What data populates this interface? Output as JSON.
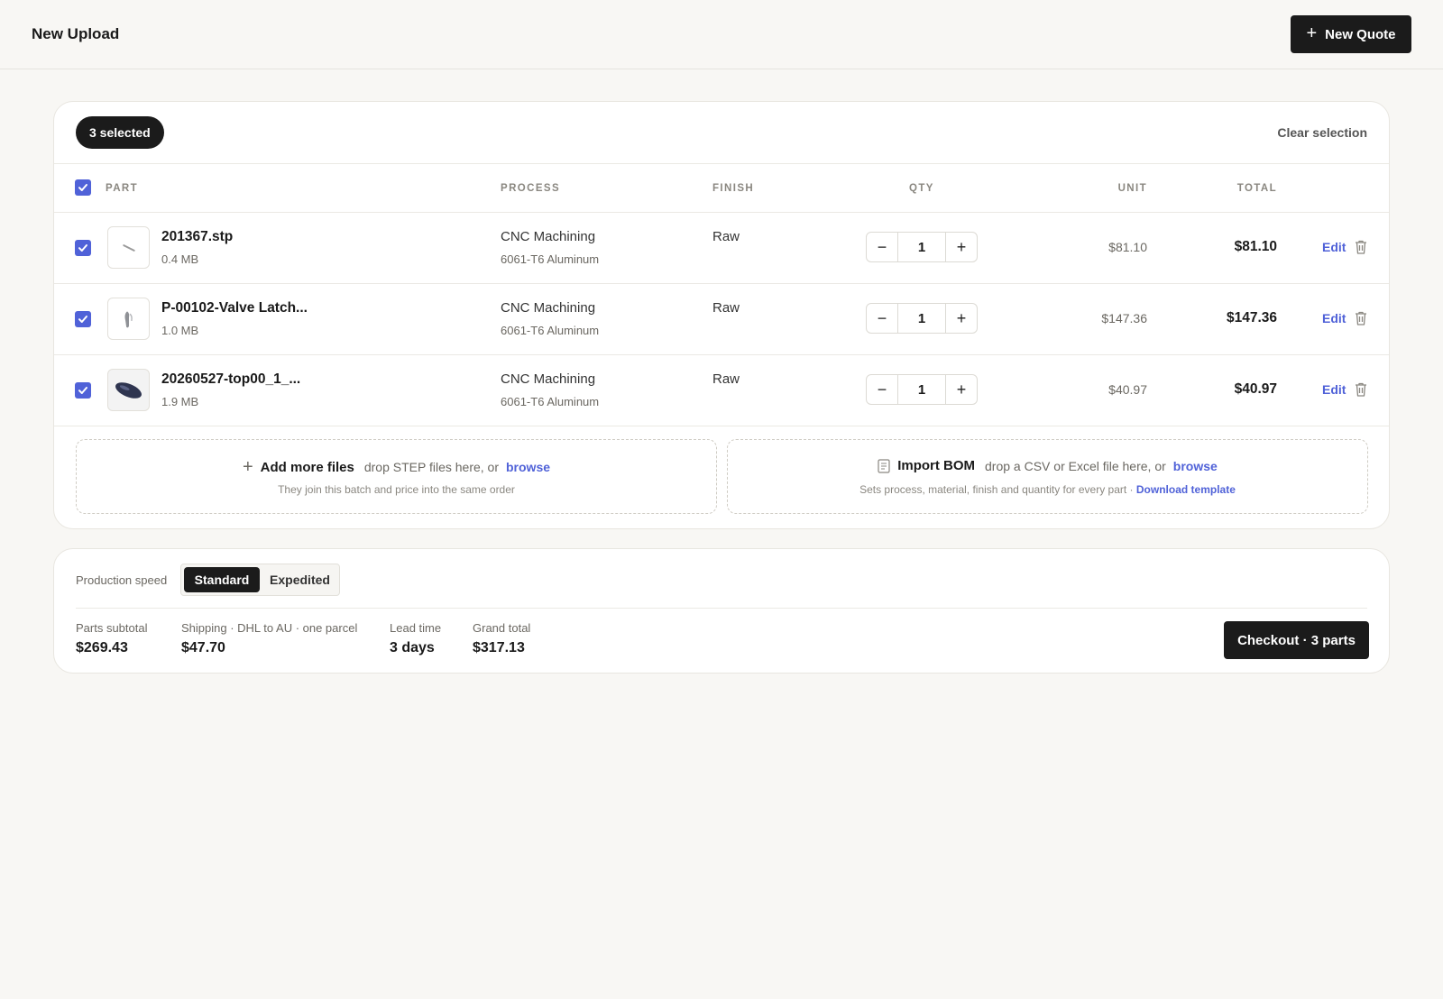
{
  "header": {
    "title": "New Upload",
    "new_quote_label": "New Quote"
  },
  "selection": {
    "badge": "3 selected",
    "clear_label": "Clear selection"
  },
  "columns": {
    "part": "PART",
    "process": "PROCESS",
    "finish": "FINISH",
    "qty": "QTY",
    "unit": "UNIT",
    "total": "TOTAL"
  },
  "parts": [
    {
      "name": "201367.stp",
      "size": "0.4 MB",
      "process": "CNC Machining",
      "material": "6061-T6 Aluminum",
      "finish": "Raw",
      "qty": "1",
      "unit": "$81.10",
      "total": "$81.10",
      "edit": "Edit",
      "checked": true
    },
    {
      "name": "P-00102-Valve Latch...",
      "size": "1.0 MB",
      "process": "CNC Machining",
      "material": "6061-T6 Aluminum",
      "finish": "Raw",
      "qty": "1",
      "unit": "$147.36",
      "total": "$147.36",
      "edit": "Edit",
      "checked": true
    },
    {
      "name": "20260527-top00_1_...",
      "size": "1.9 MB",
      "process": "CNC Machining",
      "material": "6061-T6 Aluminum",
      "finish": "Raw",
      "qty": "1",
      "unit": "$40.97",
      "total": "$40.97",
      "edit": "Edit",
      "checked": true
    }
  ],
  "add_files": {
    "title": "Add more files",
    "hint": "drop STEP files here, or",
    "browse": "browse",
    "sub": "They join this batch and price into the same order"
  },
  "import_bom": {
    "title": "Import BOM",
    "hint": "drop a CSV or Excel file here, or",
    "browse": "browse",
    "sub": "Sets process, material, finish and quantity for every part ·",
    "template_link": "Download template"
  },
  "summary": {
    "speed_label": "Production speed",
    "speed_options": [
      "Standard",
      "Expedited"
    ],
    "speed_selected": "Standard",
    "parts_subtotal_label": "Parts subtotal",
    "parts_subtotal": "$269.43",
    "shipping_label": "Shipping · DHL to AU · one parcel",
    "shipping": "$47.70",
    "lead_time_label": "Lead time",
    "lead_time": "3 days",
    "grand_total_label": "Grand total",
    "grand_total": "$317.13",
    "checkout_label": "Checkout · 3 parts"
  },
  "colors": {
    "accent": "#5062d8",
    "dark": "#1b1b1b",
    "background": "#f8f7f4"
  }
}
